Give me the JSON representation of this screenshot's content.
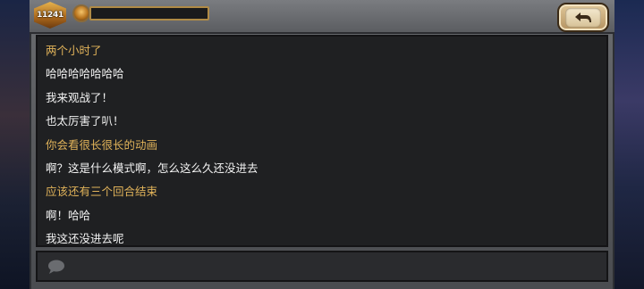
{
  "currency": {
    "amount": "11241"
  },
  "progress": {
    "value": 0
  },
  "icons": {
    "currency": "gold-hex-badge-icon",
    "gem": "gem-icon",
    "back": "back-arrow-icon",
    "chat": "speech-bubble-icon"
  },
  "colors": {
    "gold_text": "#e1b35a",
    "white_text": "#f3f3f3",
    "panel": "#1f2022"
  },
  "chat": {
    "messages": [
      {
        "text": "两个小时了",
        "style": "gold"
      },
      {
        "text": "哈哈哈哈哈哈哈",
        "style": "white"
      },
      {
        "text": "我来观战了！",
        "style": "white"
      },
      {
        "text": "也太厉害了叭！",
        "style": "white"
      },
      {
        "text": "你会看很长很长的动画",
        "style": "gold"
      },
      {
        "text": "啊？这是什么模式啊，怎么这么久还没进去",
        "style": "white"
      },
      {
        "text": "应该还有三个回合结束",
        "style": "gold"
      },
      {
        "text": "啊！哈哈",
        "style": "white"
      },
      {
        "text": "我这还没进去呢",
        "style": "white"
      }
    ],
    "input_value": ""
  }
}
